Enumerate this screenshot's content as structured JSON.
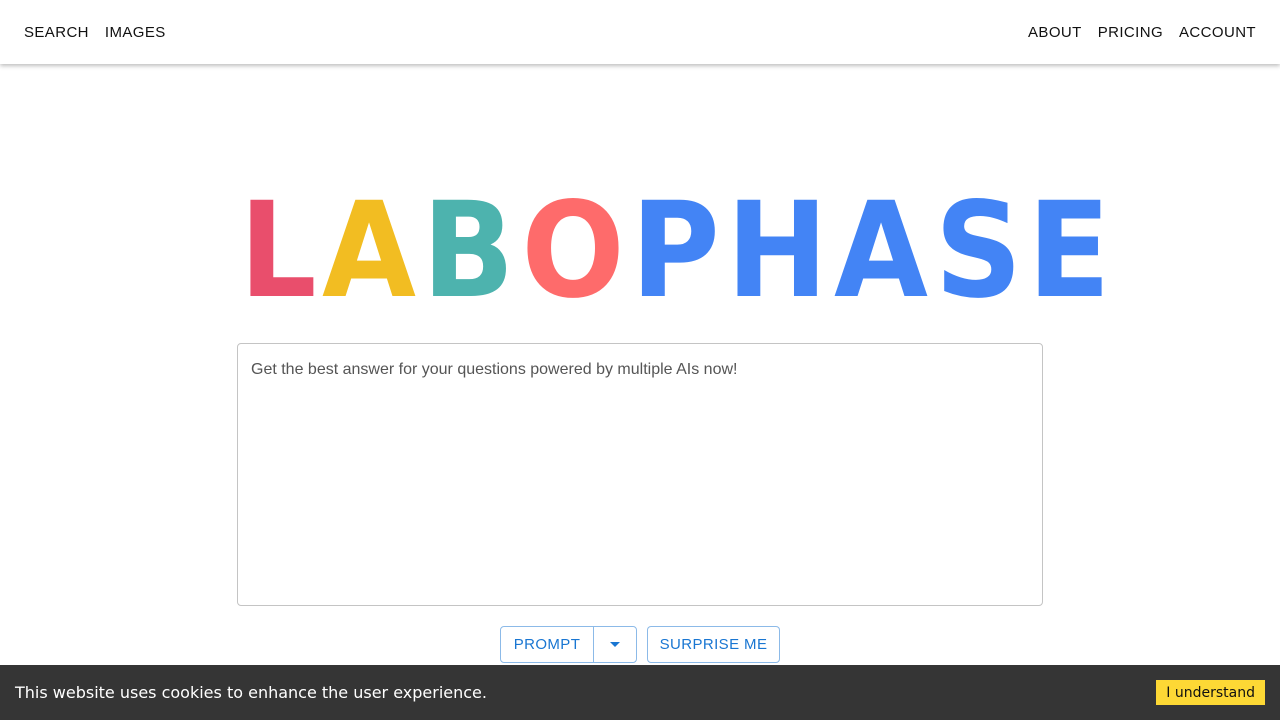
{
  "nav": {
    "left": [
      {
        "label": "SEARCH"
      },
      {
        "label": "IMAGES"
      }
    ],
    "right": [
      {
        "label": "ABOUT"
      },
      {
        "label": "PRICING"
      },
      {
        "label": "ACCOUNT"
      }
    ]
  },
  "logo": {
    "letters": [
      {
        "char": "L",
        "color": "#e94e6c"
      },
      {
        "char": "A",
        "color": "#f2bd22"
      },
      {
        "char": "B",
        "color": "#4db3ae"
      },
      {
        "char": "O",
        "color": "#fe6b6b"
      },
      {
        "char": "P",
        "color": "#4384f5"
      },
      {
        "char": "H",
        "color": "#4384f5"
      },
      {
        "char": "A",
        "color": "#4384f5"
      },
      {
        "char": "S",
        "color": "#4384f5"
      },
      {
        "char": "E",
        "color": "#4384f5"
      }
    ]
  },
  "prompt": {
    "placeholder": "Get the best answer for your questions powered by multiple AIs now!",
    "value": ""
  },
  "buttons": {
    "prompt_label": "PROMPT",
    "surprise_label": "SURPRISE ME"
  },
  "cookie": {
    "text": "This website uses cookies to enhance the user experience.",
    "accept_label": "I understand"
  },
  "colors": {
    "accent": "#1976d2",
    "cookie_bg": "#353535",
    "cookie_button": "#fdd835"
  }
}
